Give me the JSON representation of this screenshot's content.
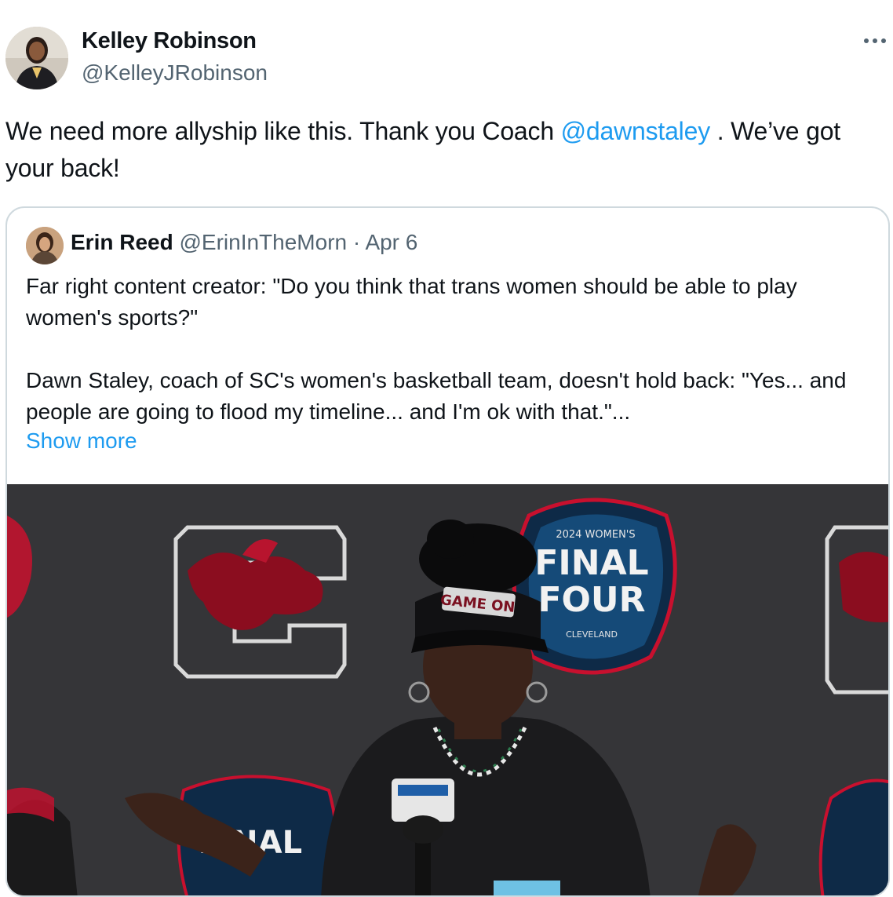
{
  "tweet": {
    "author_name": "Kelley Robinson",
    "author_handle": "@KelleyJRobinson",
    "text_part1": "We need more allyship like this. Thank you Coach ",
    "mention": "@dawnstaley",
    "text_part2": " . We’ve got your back!"
  },
  "quote": {
    "author_name": "Erin Reed",
    "author_handle": "@ErinInTheMorn",
    "separator": "·",
    "date": "Apr 6",
    "text": "Far right content creator: \"Do you think that trans women should be able to play women's sports?\"\n\nDawn Staley, coach of SC's women's basketball team, doesn't hold back: \"Yes... and people are going to flood my timeline... and I'm ok with that.\"...",
    "show_more_label": "Show more"
  },
  "media": {
    "hat_text": "GAME ON",
    "backdrop_logo_line1": "FINAL",
    "backdrop_logo_line2": "FOUR",
    "backdrop_logo_top_arc": "2024 WOMEN'S",
    "backdrop_logo_bottom_arc": "CLEVELAND"
  },
  "icons": {
    "more": "more-horizontal-icon"
  },
  "colors": {
    "link": "#1d9bf0",
    "secondary_text": "#536471",
    "border": "#cfd9de"
  }
}
